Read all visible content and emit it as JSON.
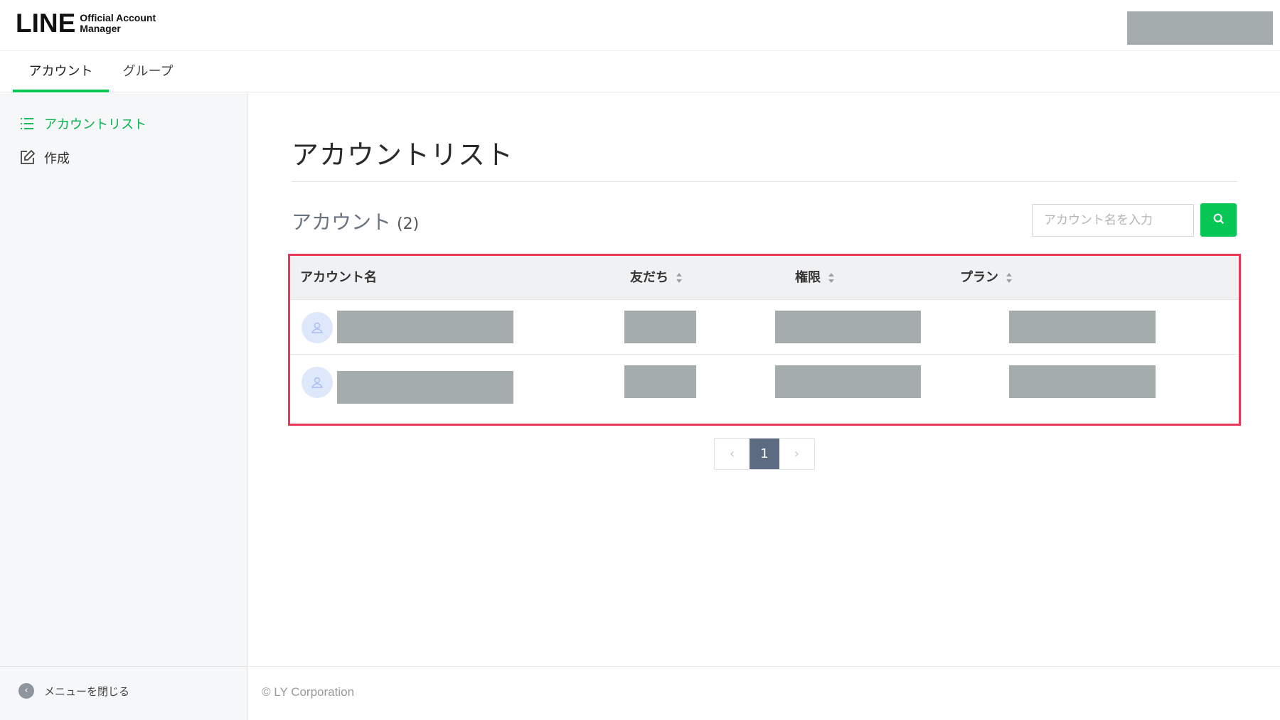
{
  "header": {
    "logo_main": "LINE",
    "logo_sub_line1": "Official Account",
    "logo_sub_line2": "Manager"
  },
  "tabs": [
    {
      "label": "アカウント",
      "active": true
    },
    {
      "label": "グループ",
      "active": false
    }
  ],
  "sidebar": {
    "items": [
      {
        "label": "アカウントリスト",
        "icon": "list-icon",
        "active": true
      },
      {
        "label": "作成",
        "icon": "edit-icon",
        "active": false
      }
    ],
    "close_menu_label": "メニューを閉じる"
  },
  "main": {
    "page_title": "アカウントリスト",
    "section_title": "アカウント",
    "section_count": "(2)",
    "search": {
      "placeholder": "アカウント名を入力"
    },
    "table": {
      "columns": [
        "アカウント名",
        "友だち",
        "権限",
        "プラン"
      ],
      "rows": 2
    },
    "pagination": {
      "prev": "‹",
      "current": "1",
      "next": "›"
    }
  },
  "footer": {
    "copyright": "© LY Corporation"
  },
  "colors": {
    "brand_green": "#06c755",
    "highlight_red": "#e83a58",
    "pager_active": "#5c6b82",
    "redacted_gray": "#a4acac"
  }
}
